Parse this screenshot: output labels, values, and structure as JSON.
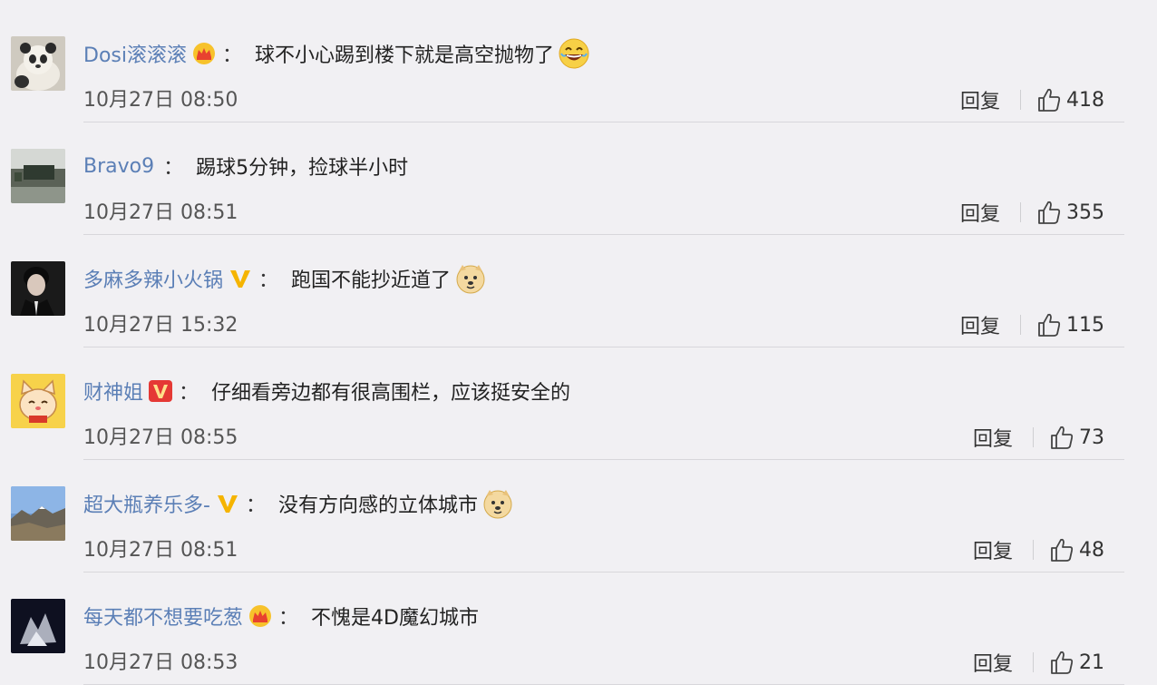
{
  "comments": [
    {
      "user": "Dosi滚滚滚",
      "badge": "crown",
      "text": "球不小心踢到楼下就是高空抛物了",
      "emoji": "laugh-emoji",
      "time": "10月27日 08:50",
      "reply": "回复",
      "likes": "418",
      "avatar": "panda"
    },
    {
      "user": "Bravo9",
      "badge": "none",
      "text": "踢球5分钟，捡球半小时",
      "emoji": "none",
      "time": "10月27日 08:51",
      "reply": "回复",
      "likes": "355",
      "avatar": "landscape"
    },
    {
      "user": "多麻多辣小火锅",
      "badge": "v-yellow",
      "text": "跑国不能抄近道了",
      "emoji": "doge-emoji",
      "time": "10月27日 15:32",
      "reply": "回复",
      "likes": "115",
      "avatar": "portrait"
    },
    {
      "user": "财神姐",
      "badge": "v-red",
      "text": "仔细看旁边都有很高围栏，应该挺安全的",
      "emoji": "none",
      "time": "10月27日 08:55",
      "reply": "回复",
      "likes": "73",
      "avatar": "cat"
    },
    {
      "user": "超大瓶养乐多-",
      "badge": "v-yellow",
      "text": "没有方向感的立体城市",
      "emoji": "doge-emoji",
      "time": "10月27日 08:51",
      "reply": "回复",
      "likes": "48",
      "avatar": "mountain"
    },
    {
      "user": "每天都不想要吃葱",
      "badge": "crown",
      "text": "不愧是4D魔幻城市",
      "emoji": "none",
      "time": "10月27日 08:53",
      "reply": "回复",
      "likes": "21",
      "avatar": "dark"
    }
  ],
  "colors": {
    "username": "#5b7fb6",
    "background": "#f1f0f3",
    "divider": "#d8d7db",
    "badge_yellow": "#f5b400",
    "badge_red": "#e53935"
  }
}
